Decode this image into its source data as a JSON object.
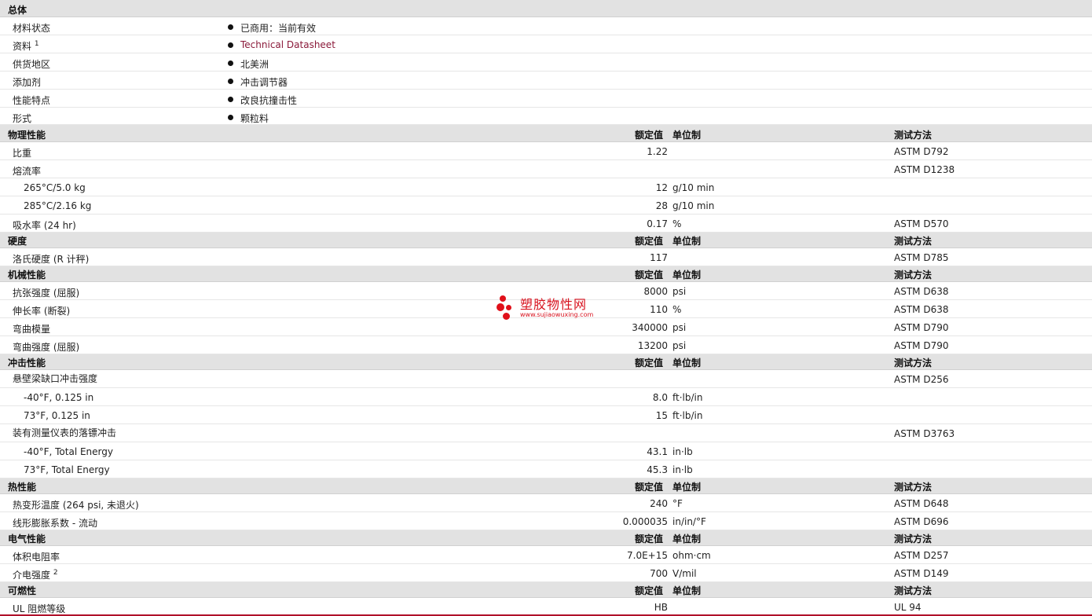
{
  "general": {
    "title": "总体",
    "rows": [
      {
        "name": "材料状态",
        "value": "已商用：当前有效"
      },
      {
        "name": "资料",
        "sup": "1",
        "value": "Technical Datasheet"
      },
      {
        "name": "供货地区",
        "value": "北美洲"
      },
      {
        "name": "添加剂",
        "value": "冲击调节器"
      },
      {
        "name": "性能特点",
        "value": "改良抗撞击性"
      },
      {
        "name": "形式",
        "value": "颗粒料"
      }
    ]
  },
  "columns": {
    "value": "额定值",
    "unit": "单位制",
    "test": "测试方法"
  },
  "physical": {
    "title": "物理性能",
    "rows": [
      {
        "name": "比重",
        "value": "1.22",
        "unit": "",
        "test": "ASTM D792"
      },
      {
        "name": "熔流率",
        "value": "",
        "unit": "",
        "test": "ASTM D1238"
      },
      {
        "name": "265°C/5.0 kg",
        "value": "12",
        "unit": "g/10 min",
        "test": ""
      },
      {
        "name": "285°C/2.16 kg",
        "value": "28",
        "unit": "g/10 min",
        "test": ""
      },
      {
        "name": "吸水率 (24 hr)",
        "value": "0.17",
        "unit": "%",
        "test": "ASTM D570"
      }
    ]
  },
  "hardness": {
    "title": "硬度",
    "rows": [
      {
        "name": "洛氏硬度 (R 计秤)",
        "value": "117",
        "unit": "",
        "test": "ASTM D785"
      }
    ]
  },
  "mechanical": {
    "title": "机械性能",
    "rows": [
      {
        "name": "抗张强度 (屈服)",
        "value": "8000",
        "unit": "psi",
        "test": "ASTM D638"
      },
      {
        "name": "伸长率 (断裂)",
        "value": "110",
        "unit": "%",
        "test": "ASTM D638"
      },
      {
        "name": "弯曲模量",
        "value": "340000",
        "unit": "psi",
        "test": "ASTM D790"
      },
      {
        "name": "弯曲强度 (屈服)",
        "value": "13200",
        "unit": "psi",
        "test": "ASTM D790"
      }
    ]
  },
  "impact": {
    "title": "冲击性能",
    "rows": [
      {
        "name": "悬壁梁缺口冲击强度",
        "value": "",
        "unit": "",
        "test": "ASTM D256"
      },
      {
        "name": "-40°F, 0.125 in",
        "value": "8.0",
        "unit": "ft·lb/in",
        "test": ""
      },
      {
        "name": "73°F, 0.125 in",
        "value": "15",
        "unit": "ft·lb/in",
        "test": ""
      },
      {
        "name": "装有测量仪表的落镖冲击",
        "value": "",
        "unit": "",
        "test": "ASTM D3763"
      },
      {
        "name": "-40°F, Total Energy",
        "value": "43.1",
        "unit": "in·lb",
        "test": ""
      },
      {
        "name": "73°F, Total Energy",
        "value": "45.3",
        "unit": "in·lb",
        "test": ""
      }
    ]
  },
  "thermal": {
    "title": "热性能",
    "rows": [
      {
        "name": "热变形温度 (264 psi, 未退火)",
        "value": "240",
        "unit": "°F",
        "test": "ASTM D648"
      },
      {
        "name": "线形膨胀系数 - 流动",
        "value": "0.000035",
        "unit": "in/in/°F",
        "test": "ASTM D696"
      }
    ]
  },
  "electrical": {
    "title": "电气性能",
    "rows": [
      {
        "name": "体积电阻率",
        "value": "7.0E+15",
        "unit": "ohm·cm",
        "test": "ASTM D257"
      },
      {
        "name": "介电强度",
        "sup": "2",
        "value": "700",
        "unit": "V/mil",
        "test": "ASTM D149"
      }
    ]
  },
  "flammability": {
    "title": "可燃性",
    "rows": [
      {
        "name": "UL 阻燃等级",
        "value": "HB",
        "unit": "",
        "test": "UL 94"
      }
    ]
  },
  "watermark": {
    "title": "塑胶物性网",
    "url": "www.sujiaowuxing.com"
  },
  "colors": {
    "header_bg": "#e2e2e2",
    "link": "#8b1a3a",
    "watermark": "#d8131f",
    "bottom_line": "#b0102a"
  }
}
